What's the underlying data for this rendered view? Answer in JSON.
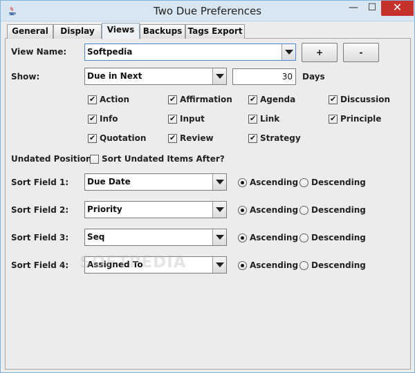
{
  "window": {
    "title": "Two Due Preferences",
    "min_glyph": "—",
    "max_glyph": "☐",
    "close_glyph": "✕"
  },
  "tabs": [
    {
      "label": "General"
    },
    {
      "label": "Display"
    },
    {
      "label": "Views",
      "selected": true
    },
    {
      "label": "Backups"
    },
    {
      "label": "Tags Export"
    }
  ],
  "view_name": {
    "label": "View Name:",
    "value": "Softpedia",
    "add_label": "+",
    "remove_label": "-"
  },
  "show": {
    "label": "Show:",
    "value": "Due in Next",
    "days_value": "30",
    "days_label": "Days"
  },
  "types": [
    {
      "label": "Action",
      "checked": true
    },
    {
      "label": "Affirmation",
      "checked": true
    },
    {
      "label": "Agenda",
      "checked": true
    },
    {
      "label": "Discussion",
      "checked": true
    },
    {
      "label": "Info",
      "checked": true
    },
    {
      "label": "Input",
      "checked": true
    },
    {
      "label": "Link",
      "checked": true
    },
    {
      "label": "Principle",
      "checked": true
    },
    {
      "label": "Quotation",
      "checked": true
    },
    {
      "label": "Review",
      "checked": true
    },
    {
      "label": "Strategy",
      "checked": true
    }
  ],
  "undated": {
    "label": "Undated Position:",
    "checkbox_label": "Sort Undated Items After?",
    "checked": false
  },
  "sort_fields": [
    {
      "label": "Sort Field 1:",
      "value": "Due Date",
      "ascending_label": "Ascending",
      "descending_label": "Descending",
      "order": "ascending"
    },
    {
      "label": "Sort Field 2:",
      "value": "Priority",
      "ascending_label": "Ascending",
      "descending_label": "Descending",
      "order": "ascending"
    },
    {
      "label": "Sort Field 3:",
      "value": "Seq",
      "ascending_label": "Ascending",
      "descending_label": "Descending",
      "order": "ascending"
    },
    {
      "label": "Sort Field 4:",
      "value": "Assigned To",
      "ascending_label": "Ascending",
      "descending_label": "Descending",
      "order": "ascending"
    }
  ],
  "watermark": "SOFTPEDIA"
}
